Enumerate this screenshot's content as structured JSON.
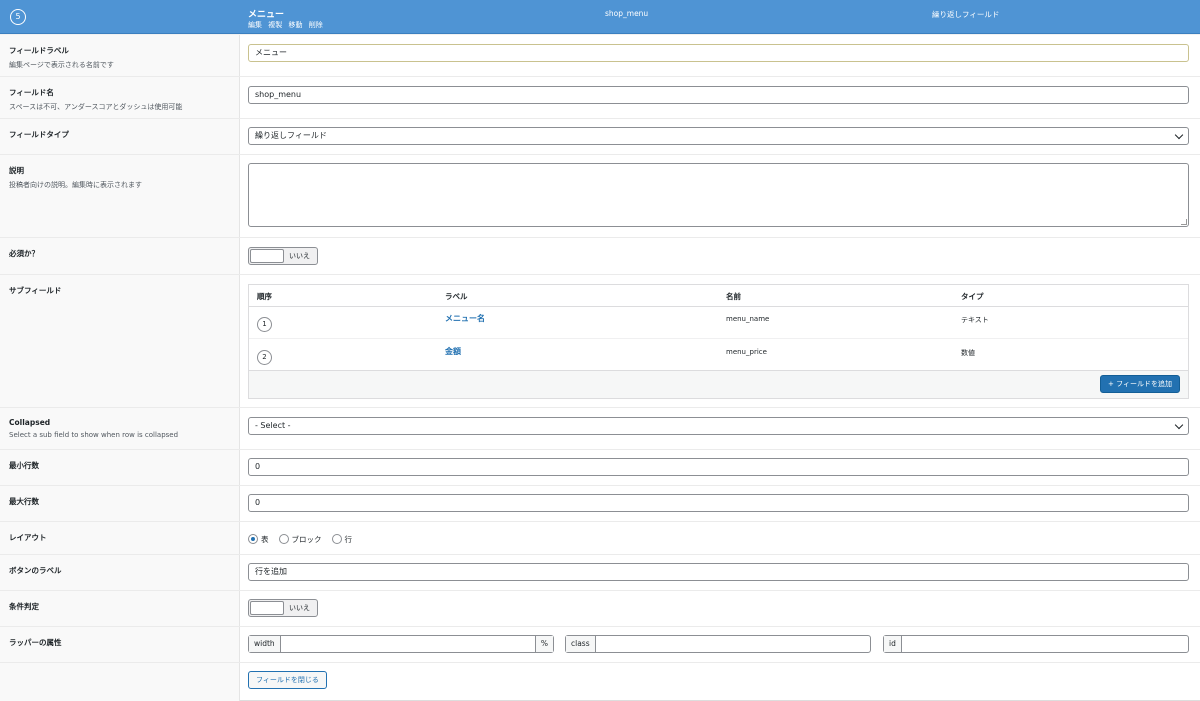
{
  "header": {
    "order": "5",
    "label": "メニュー",
    "actions": [
      "編集",
      "複製",
      "移動",
      "削除"
    ],
    "name": "shop_menu",
    "type": "繰り返しフィールド"
  },
  "field_label": {
    "title": "フィールドラベル",
    "desc": "編集ページで表示される名前です",
    "value": "メニュー"
  },
  "field_name": {
    "title": "フィールド名",
    "desc": "スペースは不可、アンダースコアとダッシュは使用可能",
    "value": "shop_menu"
  },
  "field_type": {
    "title": "フィールドタイプ",
    "value": "繰り返しフィールド"
  },
  "instructions": {
    "title": "説明",
    "desc": "投稿者向けの説明。編集時に表示されます",
    "value": ""
  },
  "required": {
    "title": "必須か？",
    "toggle_text": "いいえ"
  },
  "sub_fields": {
    "title": "サブフィールド",
    "columns": [
      "順序",
      "ラベル",
      "名前",
      "タイプ"
    ],
    "rows": [
      {
        "order": "1",
        "label": "メニュー名",
        "name": "menu_name",
        "type": "テキスト"
      },
      {
        "order": "2",
        "label": "金額",
        "name": "menu_price",
        "type": "数値"
      }
    ],
    "add_button": "+ フィールドを追加"
  },
  "collapsed": {
    "title": "Collapsed",
    "desc": "Select a sub field to show when row is collapsed",
    "value": "- Select -"
  },
  "min_rows": {
    "title": "最小行数",
    "value": "0"
  },
  "max_rows": {
    "title": "最大行数",
    "value": "0"
  },
  "layout": {
    "title": "レイアウト",
    "options": [
      "表",
      "ブロック",
      "行"
    ],
    "selected": "表"
  },
  "button_label": {
    "title": "ボタンのラベル",
    "value": "行を追加"
  },
  "conditional": {
    "title": "条件判定",
    "toggle_text": "いいえ"
  },
  "wrapper": {
    "title": "ラッパーの属性",
    "width_label": "width",
    "width_suffix": "%",
    "class_label": "class",
    "id_label": "id"
  },
  "close_button": "フィールドを閉じる",
  "colors": {
    "header_bg": "#4f94d4",
    "primary": "#2271b1",
    "link": "#2271b1"
  }
}
